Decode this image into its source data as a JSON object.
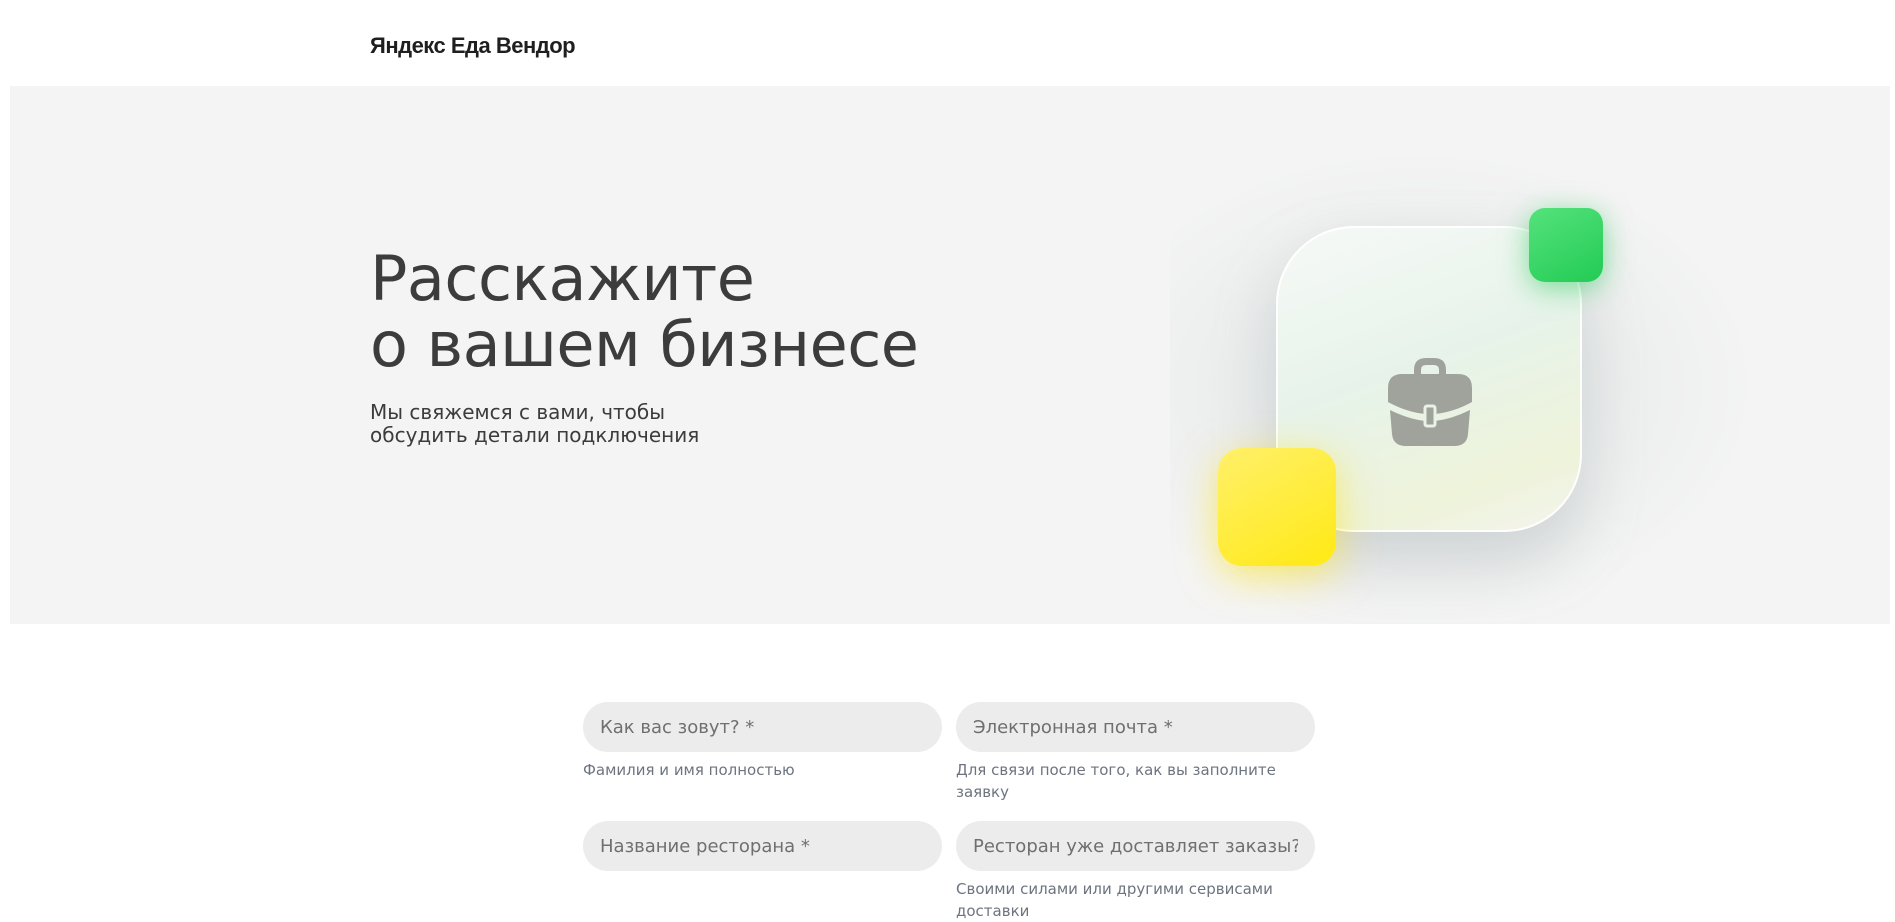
{
  "header": {
    "logo_text": "Яндекс Еда Вендор"
  },
  "hero": {
    "title_line1": "Расскажите",
    "title_line2": "о вашем бизнесе",
    "subtitle_line1": "Мы свяжемся с вами, чтобы",
    "subtitle_line2": "обсудить детали подключения",
    "icon": "briefcase-icon"
  },
  "form": {
    "name": {
      "placeholder": "Как вас зовут? *",
      "value": "",
      "hint": "Фамилия и имя полностью"
    },
    "email": {
      "placeholder": "Электронная почта *",
      "value": "",
      "hint": "Для связи после того, как вы заполните заявку"
    },
    "restaurant": {
      "placeholder": "Название ресторана *",
      "value": ""
    },
    "delivers": {
      "placeholder": "Ресторан уже доставляет заказы? *",
      "value": "",
      "hint": "Своими силами или другими сервисами доставки"
    }
  },
  "colors": {
    "hero_background": "#f4f4f4",
    "input_background": "#ececec",
    "accent_green": "#22cb54",
    "accent_yellow": "#ffe914",
    "hint_text": "#6d7480"
  }
}
